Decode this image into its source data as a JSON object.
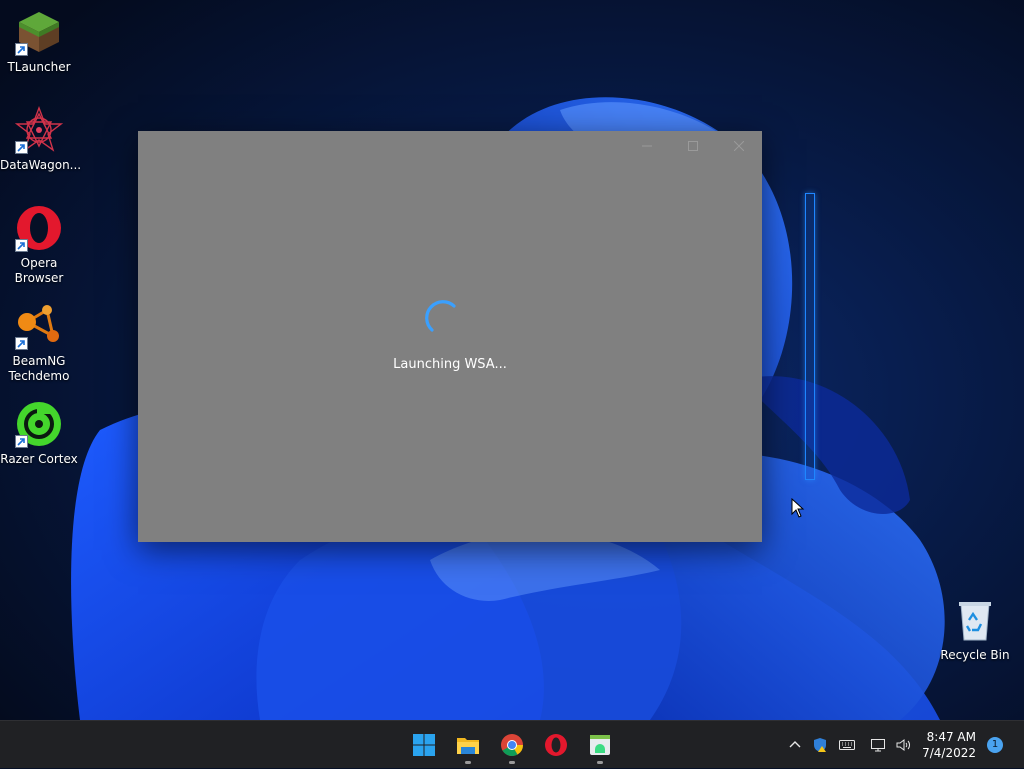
{
  "desktop": {
    "icons": [
      {
        "label": "TLauncher"
      },
      {
        "label": "DataWagon..."
      },
      {
        "label": "Opera Browser"
      },
      {
        "label": "BeamNG Techdemo"
      },
      {
        "label": "Razer Cortex"
      },
      {
        "label": "Recycle Bin"
      }
    ]
  },
  "window": {
    "status_text": "Launching WSA...",
    "controls": [
      "minimize-icon",
      "maximize-icon",
      "close-icon"
    ]
  },
  "taskbar": {
    "apps": [
      "windows-start-icon",
      "file-explorer-icon",
      "chrome-icon",
      "opera-icon",
      "android-app-icon"
    ],
    "tray_icons": [
      "chevron-up-icon",
      "shield-warning-icon",
      "keyboard-icon",
      "network-icon",
      "volume-icon"
    ],
    "clock": {
      "time": "8:47 AM",
      "date": "7/4/2022"
    },
    "notification_count": "1"
  },
  "colors": {
    "window_bg": "#808080",
    "taskbar_bg": "#202124",
    "accent": "#1f86ff",
    "spinner": "#3aa0ff"
  }
}
